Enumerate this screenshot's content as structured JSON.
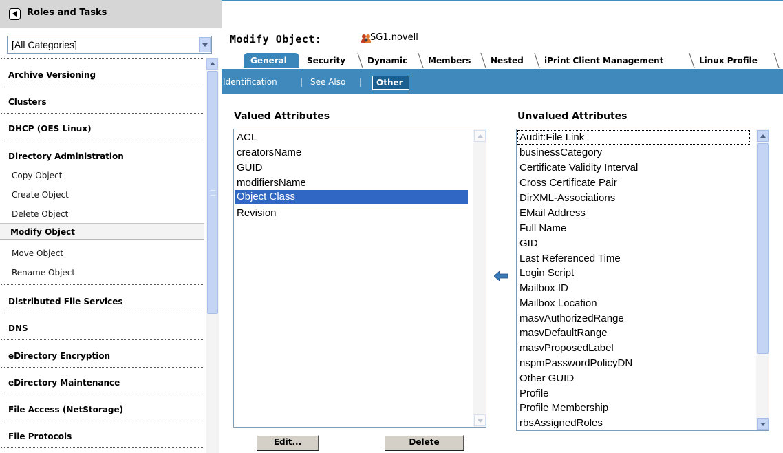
{
  "left_pane": {
    "title": "Roles and Tasks",
    "category_select": {
      "value": "[All Categories]"
    },
    "nav_items": [
      {
        "label": "Archive Versioning",
        "kind": "category"
      },
      {
        "label": "Clusters",
        "kind": "category"
      },
      {
        "label": "DHCP (OES Linux)",
        "kind": "category"
      },
      {
        "label": "Directory Administration",
        "kind": "category"
      },
      {
        "label": "Copy Object",
        "kind": "task"
      },
      {
        "label": "Create Object",
        "kind": "task"
      },
      {
        "label": "Delete Object",
        "kind": "task"
      },
      {
        "label": "Modify Object",
        "kind": "task",
        "selected": true
      },
      {
        "label": "Move Object",
        "kind": "task"
      },
      {
        "label": "Rename Object",
        "kind": "task"
      },
      {
        "label": "Distributed File Services",
        "kind": "category"
      },
      {
        "label": "DNS",
        "kind": "category"
      },
      {
        "label": "eDirectory Encryption",
        "kind": "category"
      },
      {
        "label": "eDirectory Maintenance",
        "kind": "category"
      },
      {
        "label": "File Access (NetStorage)",
        "kind": "category"
      },
      {
        "label": "File Protocols",
        "kind": "category"
      }
    ]
  },
  "main": {
    "page_title": "Modify Object:",
    "object_name": "SG1.novell",
    "object_icon": "group-icon",
    "tabs": [
      {
        "label": "General",
        "active": true
      },
      {
        "label": "Security"
      },
      {
        "label": "Dynamic"
      },
      {
        "label": "Members"
      },
      {
        "label": "Nested"
      },
      {
        "label": "iPrint Client Management"
      },
      {
        "label": "Linux Profile"
      }
    ],
    "subtabs": [
      {
        "label": "Identification"
      },
      {
        "label": "See Also"
      },
      {
        "label": "Other",
        "active": true
      }
    ],
    "subtab_separator": "|",
    "valued": {
      "heading": "Valued Attributes",
      "items": [
        "ACL",
        "creatorsName",
        "GUID",
        "modifiersName",
        "Object Class",
        "Revision"
      ],
      "selected_item": "Object Class"
    },
    "unvalued": {
      "heading": "Unvalued Attributes",
      "items": [
        "Audit:File Link",
        "businessCategory",
        "Certificate Validity Interval",
        "Cross Certificate Pair",
        "DirXML-Associations",
        "EMail Address",
        "Full Name",
        "GID",
        "Last Referenced Time",
        "Login Script",
        "Mailbox ID",
        "Mailbox Location",
        "masvAuthorizedRange",
        "masvDefaultRange",
        "masvProposedLabel",
        "nspmPasswordPolicyDN",
        "Other GUID",
        "Profile",
        "Profile Membership",
        "rbsAssignedRoles"
      ],
      "focused_item": "Audit:File Link"
    },
    "move_arrow_icon": "arrow-left-icon",
    "buttons": {
      "edit": "Edit...",
      "delete": "Delete"
    }
  },
  "colors": {
    "accent_blue": "#4089bd",
    "active_tab": "#3a86bb",
    "selection": "#3167c4",
    "left_header": "#d6d6d6"
  }
}
